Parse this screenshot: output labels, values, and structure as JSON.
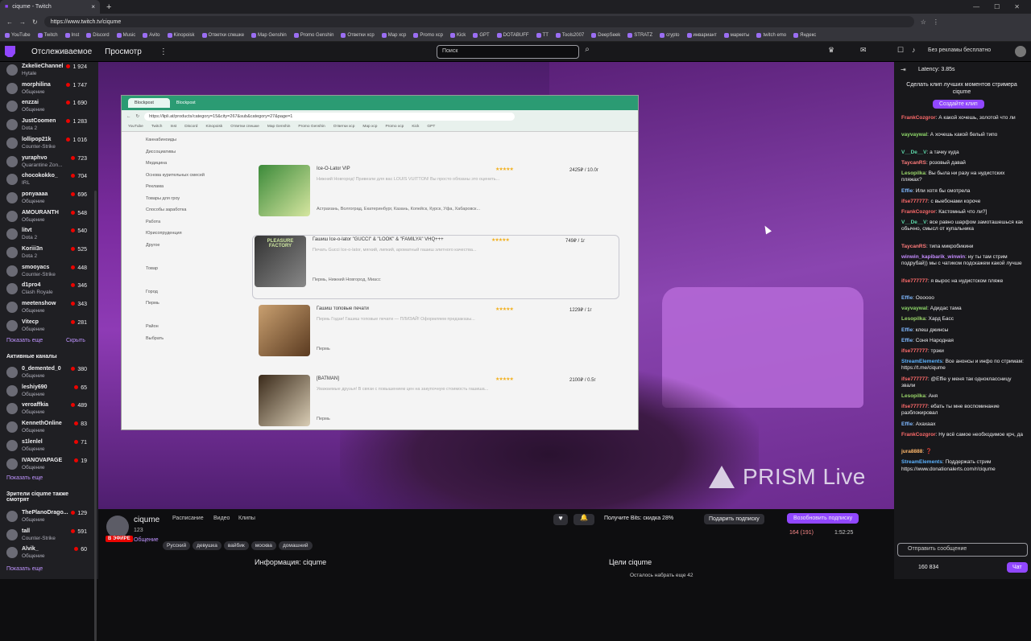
{
  "browser": {
    "tab_title": "ciqume - Twitch",
    "url": "https://www.twitch.tv/ciqume"
  },
  "bookmarks": [
    "YouTube",
    "Twitch",
    "Inst",
    "Discord",
    "Music",
    "Avito",
    "Kinopoisk",
    "Ответки спешке",
    "Map Genshin",
    "Promo Genshin",
    "Ответки хср",
    "Map хср",
    "Promo хср",
    "Kick",
    "GPT",
    "DOTABUFF",
    "TT",
    "Tools2007",
    "DeepSeek",
    "STRATZ",
    "crypto",
    "инвариант",
    "маркеты",
    "twitch emo",
    "Яндекс"
  ],
  "nav": {
    "following": "Отслеживаемое",
    "browse": "Просмотр",
    "more": "⋮",
    "search_placeholder": "Поиск",
    "turbo": "Без рекламы бесплатно"
  },
  "sidebar": {
    "channels": [
      {
        "name": "ZxkelieChannel",
        "game": "Hytale",
        "viewers": "1 924"
      },
      {
        "name": "morphilina",
        "game": "Общение",
        "viewers": "1 747"
      },
      {
        "name": "enzzai",
        "game": "Общение",
        "viewers": "1 690"
      },
      {
        "name": "JustCoomen",
        "game": "Dota 2",
        "viewers": "1 283"
      },
      {
        "name": "lollipop21k",
        "game": "Counter-Strike",
        "viewers": "1 016"
      },
      {
        "name": "yuraphvo",
        "game": "Quarantine Zon...",
        "viewers": "723"
      },
      {
        "name": "chocokokko_",
        "game": "IRL",
        "viewers": "704"
      },
      {
        "name": "ponyaaaa",
        "game": "Общение",
        "viewers": "696"
      },
      {
        "name": "AMOURANTH",
        "game": "Общение",
        "viewers": "548"
      },
      {
        "name": "litvt",
        "game": "Dota 2",
        "viewers": "540"
      },
      {
        "name": "Koriii3n",
        "game": "Dota 2",
        "viewers": "525"
      },
      {
        "name": "smooyacs",
        "game": "Counter-Strike",
        "viewers": "448"
      },
      {
        "name": "d1pro4",
        "game": "Clash Royale",
        "viewers": "346"
      },
      {
        "name": "meetenshow",
        "game": "Общение",
        "viewers": "343"
      },
      {
        "name": "Vitecp",
        "game": "Общение",
        "viewers": "281"
      }
    ],
    "show_more": "Показать еще",
    "hide": "Скрыть",
    "active_header": "Активные каналы",
    "active": [
      {
        "name": "0_demented_0",
        "game": "Общение",
        "viewers": "380"
      },
      {
        "name": "leshiy690",
        "game": "Общение",
        "viewers": "65"
      },
      {
        "name": "veroaffkia",
        "game": "Общение",
        "viewers": "489"
      },
      {
        "name": "KennethOnline",
        "game": "Общение",
        "viewers": "83"
      },
      {
        "name": "s1lenlel",
        "game": "Общение",
        "viewers": "71"
      },
      {
        "name": "IVANOVAPAGE",
        "game": "Общение",
        "viewers": "19"
      }
    ],
    "show_more2": "Показать еще",
    "also_header": "Зрители ciqume также смотрят",
    "also": [
      {
        "name": "ThePlanoDrago...",
        "game": "Общение",
        "viewers": "129"
      },
      {
        "name": "tall",
        "game": "Counter-Strike",
        "viewers": "591"
      },
      {
        "name": "Alvik_",
        "game": "Общение",
        "viewers": "60"
      }
    ],
    "show_more3": "Показать еще"
  },
  "inner": {
    "tab1": "Blockpost",
    "url": "https://lipli.at/products/category=15&city=267&sub&category=27&page=1",
    "bookmarks": [
      "YouTube",
      "Twitch",
      "Inst",
      "Discord",
      "Kinopoisk",
      "Ответки спешке",
      "Map Genshin",
      "Promo Genshin",
      "Ответки хср",
      "Map хср",
      "Promo хср",
      "Kick",
      "GPT"
    ],
    "filters": [
      "Каннабиноиды",
      "Диссоциативы",
      "Медицина",
      "Основа курительных смесей",
      "Реклама",
      "Товары для гроу",
      "Способы заработка",
      "Работа",
      "Юрисопруденция",
      "Другое",
      "",
      "Товар",
      "",
      "Город",
      "Пермь",
      "",
      "Район",
      "Выбрать"
    ],
    "products": [
      {
        "title": "Ice-O-Lator VIP",
        "stars": "★★★★★",
        "price": "2425₽ / 10.0г",
        "desc": "Нижний Новгород! Привезли для вас LOUIS VUITTON! Вы просто обязаны это оценить...",
        "cities": "Астрахань, Волгоград, Екатеринбург, Казань, Копейск, Курск, Уфа, Хабаровск..."
      },
      {
        "title": "Гашиш Ice-o-lator \"GUCCI\" & \"LOOK\" & \"FAMILYA\" VHQ+++",
        "stars": "★★★★★",
        "price": "749₽ / 1г",
        "desc": "Печать Gucci Ice-o-lator, мягкий, липкий, ароматный гашиш элитного качества...",
        "cities": "Пермь, Нижний Новгород, Миасс",
        "badge": "PLEASURE FACTORY"
      },
      {
        "title": "Гашиш топовые печати",
        "stars": "★★★★★",
        "price": "1229₽ / 1г",
        "desc": "Пермь Годзи! Гашиш топовые печати — ПЛИЗАЙ! Оформляем предзаказы...",
        "cities": "Пермь"
      },
      {
        "title": "[BATMAN]",
        "stars": "★★★★★",
        "price": "2100₽ / 0.5г",
        "desc": "Уважаемые друзья! В связи с повышением цен на закупочную стоимость гашиша...",
        "cities": "Пермь"
      }
    ]
  },
  "video": {
    "overlay": "PRISM Live"
  },
  "info": {
    "channel": "ciqume",
    "level": "123",
    "live": "В ЭФИРЕ",
    "game": "Общение",
    "links": [
      "Расписание",
      "Видео",
      "Клипы"
    ],
    "tags": [
      "Русский",
      "девушка",
      "вайбик",
      "москва",
      "домашний"
    ],
    "bits": "Получите Bits: скидка 28%",
    "gift": "Подарить подписку",
    "sub": "Возобновить подписку",
    "viewers": "164 (191)",
    "uptime": "1:52:25",
    "about": "Информация: ciqume",
    "goals": "Цели ciqume",
    "goal_progress": "Осталось набрать еще 42"
  },
  "chat": {
    "latency": "Latency: 3.85s",
    "clip_prompt": "Сделать клип лучших моментов стримера ciqume",
    "clip_button": "Создайте клип",
    "messages": [
      {
        "user": "FrankCozgror",
        "color": "#ff6b6b",
        "text": "А какой хочешь, золотой что ли"
      },
      {
        "user": "vayvaywal",
        "color": "#8fd96a",
        "text": "А хочешь какой белый типо"
      },
      {
        "user": "V__De__V",
        "color": "#5cd6a8",
        "text": "а тачку куда"
      },
      {
        "user": "TaycanRS",
        "color": "#ff7b7b",
        "text": "розовый давай"
      },
      {
        "user": "Lesopilka",
        "color": "#9ad66a",
        "text": "Вы была ни разу на нудистских пляжах?"
      },
      {
        "user": "Effie",
        "color": "#7fb8ff",
        "text": "Или хотя бы смотрела"
      },
      {
        "user": "ifse777777",
        "color": "#ff6b6b",
        "text": "с выебонами короче"
      },
      {
        "user": "FrankCozgror",
        "color": "#ff6b6b",
        "text": "Кастомный что ли?]"
      },
      {
        "user": "V__De__V",
        "color": "#5cd6a8",
        "text": "все равно шарфом замоташешься как обычно, смысл от купальника"
      },
      {
        "user": "TaycanRS",
        "color": "#ff7b7b",
        "text": "типа микробикини"
      },
      {
        "user": "winwin_kapibarik_winwin",
        "color": "#c58cff",
        "text": "ну ты там стрим подрубай)) мы с чатиком подскажем какой лучше"
      },
      {
        "user": "ifse777777",
        "color": "#ff6b6b",
        "text": "я вырос на нудистском пляже"
      },
      {
        "user": "Effie",
        "color": "#7fb8ff",
        "text": "Ооoooo"
      },
      {
        "user": "vayvaywal",
        "color": "#8fd96a",
        "text": "Адидас тама"
      },
      {
        "user": "Lesopilka",
        "color": "#9ad66a",
        "text": "Хард Басс"
      },
      {
        "user": "Effie",
        "color": "#7fb8ff",
        "text": "клеш джинсы"
      },
      {
        "user": "Effie",
        "color": "#7fb8ff",
        "text": "Соня Народная"
      },
      {
        "user": "ifse777777",
        "color": "#ff6b6b",
        "text": "трэки"
      },
      {
        "user": "StreamElements",
        "color": "#5cb3ff",
        "text": "Все анонсы и инфо по стримам: https://t.me/ciqume"
      },
      {
        "user": "ifse777777",
        "color": "#ff6b6b",
        "text": "@Effie у меня так одноклассницу звали"
      },
      {
        "user": "Lesopilka",
        "color": "#9ad66a",
        "text": "Аня"
      },
      {
        "user": "ifse777777",
        "color": "#ff6b6b",
        "text": "ебать ты мне воспоминание разблокировал"
      },
      {
        "user": "Effie",
        "color": "#7fb8ff",
        "text": "Ахахаах"
      },
      {
        "user": "FrankCozgror",
        "color": "#ff6b6b",
        "text": "Ну всё самое необходимое крч, да"
      },
      {
        "user": "jura8888",
        "color": "#ffb86b",
        "text": "❓"
      },
      {
        "user": "StreamElements",
        "color": "#5cb3ff",
        "text": "Поддержать стрим https://www.donationalerts.com/r/ciqume"
      }
    ],
    "input_placeholder": "Отправить сообщение",
    "points": "160 834",
    "send": "Чат"
  }
}
